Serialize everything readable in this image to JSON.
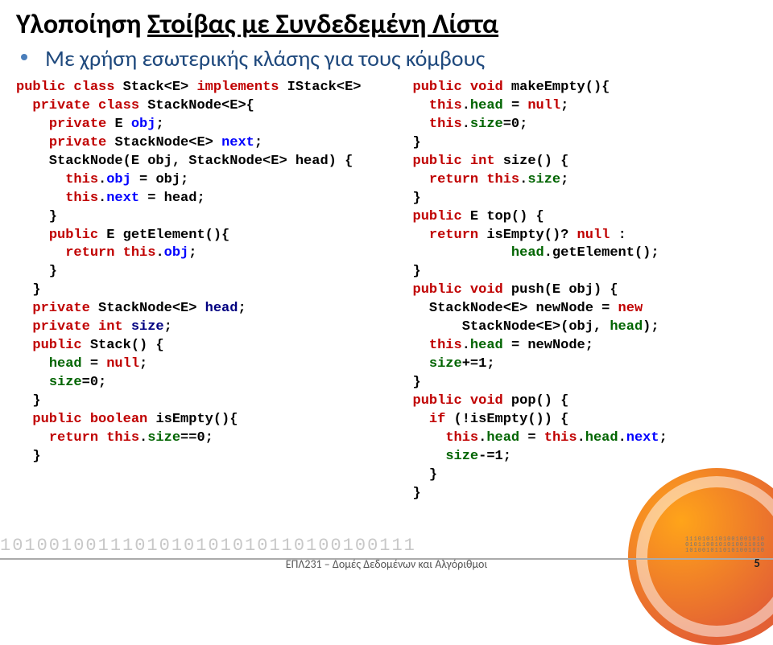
{
  "title_prefix": "Υλοποίηση ",
  "title_underlined": "Στοίβας με Συνδεδεμένη Λίστα",
  "subtitle": "Με χρήση εσωτερικής κλάσης για τους κόμβους",
  "code_left": [
    {
      "cls": "k-red",
      "t": "public class "
    },
    {
      "cls": "k-black",
      "t": "Stack<E> "
    },
    {
      "cls": "k-red",
      "t": "implements "
    },
    {
      "cls": "k-black",
      "t": "IStack<E>"
    },
    {
      "br": 1
    },
    {
      "cls": "k-black",
      "t": "  "
    },
    {
      "cls": "k-red",
      "t": "private class "
    },
    {
      "cls": "k-black",
      "t": "StackNode<E>{"
    },
    {
      "br": 1
    },
    {
      "cls": "k-black",
      "t": "    "
    },
    {
      "cls": "k-red",
      "t": "private "
    },
    {
      "cls": "k-black",
      "t": "E "
    },
    {
      "cls": "k-blue",
      "t": "obj"
    },
    {
      "cls": "k-black",
      "t": ";"
    },
    {
      "br": 1
    },
    {
      "cls": "k-black",
      "t": "    "
    },
    {
      "cls": "k-red",
      "t": "private "
    },
    {
      "cls": "k-black",
      "t": "StackNode<E> "
    },
    {
      "cls": "k-blue",
      "t": "next"
    },
    {
      "cls": "k-black",
      "t": ";"
    },
    {
      "br": 1
    },
    {
      "cls": "k-black",
      "t": "    StackNode(E obj, StackNode<E> head) {"
    },
    {
      "br": 1
    },
    {
      "cls": "k-black",
      "t": "      "
    },
    {
      "cls": "k-red",
      "t": "this"
    },
    {
      "cls": "k-black",
      "t": "."
    },
    {
      "cls": "k-blue",
      "t": "obj "
    },
    {
      "cls": "k-black",
      "t": "= obj;"
    },
    {
      "br": 1
    },
    {
      "cls": "k-black",
      "t": "      "
    },
    {
      "cls": "k-red",
      "t": "this"
    },
    {
      "cls": "k-black",
      "t": "."
    },
    {
      "cls": "k-blue",
      "t": "next "
    },
    {
      "cls": "k-black",
      "t": "= head;"
    },
    {
      "br": 1
    },
    {
      "cls": "k-black",
      "t": "    }"
    },
    {
      "br": 1
    },
    {
      "cls": "k-black",
      "t": "    "
    },
    {
      "cls": "k-red",
      "t": "public "
    },
    {
      "cls": "k-black",
      "t": "E getElement(){"
    },
    {
      "br": 1
    },
    {
      "cls": "k-black",
      "t": "      "
    },
    {
      "cls": "k-red",
      "t": "return this"
    },
    {
      "cls": "k-black",
      "t": "."
    },
    {
      "cls": "k-blue",
      "t": "obj"
    },
    {
      "cls": "k-black",
      "t": ";"
    },
    {
      "br": 1
    },
    {
      "cls": "k-black",
      "t": "    }"
    },
    {
      "br": 1
    },
    {
      "cls": "k-black",
      "t": "  }"
    },
    {
      "br": 1
    },
    {
      "cls": "k-black",
      "t": "  "
    },
    {
      "cls": "k-red",
      "t": "private "
    },
    {
      "cls": "k-black",
      "t": "StackNode<E> "
    },
    {
      "cls": "k-nav",
      "t": "head"
    },
    {
      "cls": "k-black",
      "t": ";"
    },
    {
      "br": 1
    },
    {
      "cls": "k-black",
      "t": "  "
    },
    {
      "cls": "k-red",
      "t": "private int "
    },
    {
      "cls": "k-nav",
      "t": "size"
    },
    {
      "cls": "k-black",
      "t": ";"
    },
    {
      "br": 1
    },
    {
      "cls": "k-black",
      "t": "  "
    },
    {
      "cls": "k-red",
      "t": "public "
    },
    {
      "cls": "k-black",
      "t": "Stack() {"
    },
    {
      "br": 1
    },
    {
      "cls": "k-black",
      "t": "    "
    },
    {
      "cls": "k-green",
      "t": "head "
    },
    {
      "cls": "k-black",
      "t": "= "
    },
    {
      "cls": "k-red",
      "t": "null"
    },
    {
      "cls": "k-black",
      "t": ";"
    },
    {
      "br": 1
    },
    {
      "cls": "k-black",
      "t": "    "
    },
    {
      "cls": "k-green",
      "t": "size"
    },
    {
      "cls": "k-black",
      "t": "=0;"
    },
    {
      "br": 1
    },
    {
      "cls": "k-black",
      "t": "  }"
    },
    {
      "br": 1
    },
    {
      "cls": "k-black",
      "t": "  "
    },
    {
      "cls": "k-red",
      "t": "public boolean "
    },
    {
      "cls": "k-black",
      "t": "isEmpty(){"
    },
    {
      "br": 1
    },
    {
      "cls": "k-black",
      "t": "    "
    },
    {
      "cls": "k-red",
      "t": "return this"
    },
    {
      "cls": "k-black",
      "t": "."
    },
    {
      "cls": "k-green",
      "t": "size"
    },
    {
      "cls": "k-black",
      "t": "==0;"
    },
    {
      "br": 1
    },
    {
      "cls": "k-black",
      "t": "  }"
    }
  ],
  "code_right": [
    {
      "cls": "k-red",
      "t": "public void "
    },
    {
      "cls": "k-black",
      "t": "makeEmpty(){"
    },
    {
      "br": 1
    },
    {
      "cls": "k-black",
      "t": "  "
    },
    {
      "cls": "k-red",
      "t": "this"
    },
    {
      "cls": "k-black",
      "t": "."
    },
    {
      "cls": "k-green",
      "t": "head "
    },
    {
      "cls": "k-black",
      "t": "= "
    },
    {
      "cls": "k-red",
      "t": "null"
    },
    {
      "cls": "k-black",
      "t": ";"
    },
    {
      "br": 1
    },
    {
      "cls": "k-black",
      "t": "  "
    },
    {
      "cls": "k-red",
      "t": "this"
    },
    {
      "cls": "k-black",
      "t": "."
    },
    {
      "cls": "k-green",
      "t": "size"
    },
    {
      "cls": "k-black",
      "t": "=0;"
    },
    {
      "br": 1
    },
    {
      "cls": "k-black",
      "t": "}"
    },
    {
      "br": 1
    },
    {
      "cls": "k-red",
      "t": "public int "
    },
    {
      "cls": "k-black",
      "t": "size() {"
    },
    {
      "br": 1
    },
    {
      "cls": "k-black",
      "t": "  "
    },
    {
      "cls": "k-red",
      "t": "return this"
    },
    {
      "cls": "k-black",
      "t": "."
    },
    {
      "cls": "k-green",
      "t": "size"
    },
    {
      "cls": "k-black",
      "t": ";"
    },
    {
      "br": 1
    },
    {
      "cls": "k-black",
      "t": "}"
    },
    {
      "br": 1
    },
    {
      "cls": "k-red",
      "t": "public "
    },
    {
      "cls": "k-black",
      "t": "E top() {"
    },
    {
      "br": 1
    },
    {
      "cls": "k-black",
      "t": "  "
    },
    {
      "cls": "k-red",
      "t": "return "
    },
    {
      "cls": "k-black",
      "t": "isEmpty()? "
    },
    {
      "cls": "k-red",
      "t": "null "
    },
    {
      "cls": "k-black",
      "t": ":"
    },
    {
      "br": 1
    },
    {
      "cls": "k-black",
      "t": "            "
    },
    {
      "cls": "k-green",
      "t": "head"
    },
    {
      "cls": "k-black",
      "t": ".getElement();"
    },
    {
      "br": 1
    },
    {
      "cls": "k-black",
      "t": "}"
    },
    {
      "br": 1
    },
    {
      "cls": "k-red",
      "t": "public void "
    },
    {
      "cls": "k-black",
      "t": "push(E obj) {"
    },
    {
      "br": 1
    },
    {
      "cls": "k-black",
      "t": "  StackNode<E> newNode = "
    },
    {
      "cls": "k-red",
      "t": "new"
    },
    {
      "br": 1
    },
    {
      "cls": "k-black",
      "t": "      StackNode<E>(obj, "
    },
    {
      "cls": "k-green",
      "t": "head"
    },
    {
      "cls": "k-black",
      "t": ");"
    },
    {
      "br": 1
    },
    {
      "cls": "k-black",
      "t": "  "
    },
    {
      "cls": "k-red",
      "t": "this"
    },
    {
      "cls": "k-black",
      "t": "."
    },
    {
      "cls": "k-green",
      "t": "head "
    },
    {
      "cls": "k-black",
      "t": "= newNode;"
    },
    {
      "br": 1
    },
    {
      "cls": "k-black",
      "t": "  "
    },
    {
      "cls": "k-green",
      "t": "size"
    },
    {
      "cls": "k-black",
      "t": "+=1;"
    },
    {
      "br": 1
    },
    {
      "cls": "k-black",
      "t": "}"
    },
    {
      "br": 1
    },
    {
      "cls": "k-red",
      "t": "public void "
    },
    {
      "cls": "k-black",
      "t": "pop() {"
    },
    {
      "br": 1
    },
    {
      "cls": "k-black",
      "t": "  "
    },
    {
      "cls": "k-red",
      "t": "if "
    },
    {
      "cls": "k-black",
      "t": "(!isEmpty()) {"
    },
    {
      "br": 1
    },
    {
      "cls": "k-black",
      "t": "    "
    },
    {
      "cls": "k-red",
      "t": "this"
    },
    {
      "cls": "k-black",
      "t": "."
    },
    {
      "cls": "k-green",
      "t": "head "
    },
    {
      "cls": "k-black",
      "t": "= "
    },
    {
      "cls": "k-red",
      "t": "this"
    },
    {
      "cls": "k-black",
      "t": "."
    },
    {
      "cls": "k-green",
      "t": "head"
    },
    {
      "cls": "k-black",
      "t": "."
    },
    {
      "cls": "k-blue",
      "t": "next"
    },
    {
      "cls": "k-black",
      "t": ";"
    },
    {
      "br": 1
    },
    {
      "cls": "k-black",
      "t": "    "
    },
    {
      "cls": "k-green",
      "t": "size"
    },
    {
      "cls": "k-black",
      "t": "-=1;"
    },
    {
      "br": 1
    },
    {
      "cls": "k-black",
      "t": "  }"
    },
    {
      "br": 1
    },
    {
      "cls": "k-black",
      "t": "}"
    }
  ],
  "footer": "ΕΠΛ231 – Δομές Δεδομένων και Αλγόριθμοι",
  "page": "5",
  "binary": "1010010011101010101010110100100111",
  "dots": "1110101101001001010\n0101100101010011010\n1010010110101001010"
}
